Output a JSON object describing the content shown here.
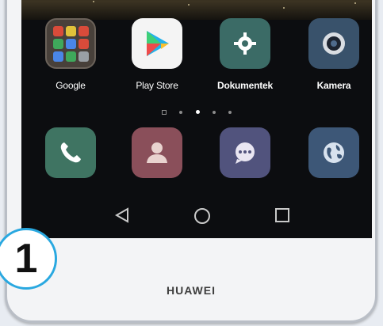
{
  "home": {
    "apps": [
      {
        "label": "Google",
        "icon": "folder-icon"
      },
      {
        "label": "Play Store",
        "icon": "play-store-icon"
      },
      {
        "label": "Dokumentek",
        "icon": "gear-icon"
      },
      {
        "label": "Kamera",
        "icon": "camera-icon"
      }
    ],
    "page_indicator": {
      "pages": 5,
      "active": 2
    }
  },
  "dock": [
    {
      "icon": "phone-icon"
    },
    {
      "icon": "contacts-icon"
    },
    {
      "icon": "messages-icon"
    },
    {
      "icon": "browser-icon"
    }
  ],
  "navbar": [
    {
      "icon": "back-icon"
    },
    {
      "icon": "home-icon"
    },
    {
      "icon": "recents-icon"
    }
  ],
  "device": {
    "brand": "HUAWEI"
  },
  "step": {
    "number": "1"
  },
  "colors": {
    "screen": "#0c0d10",
    "phone_app": "#3f7462",
    "contacts_app": "#8a4f5a",
    "messages_app": "#51537d",
    "browser_app": "#3d5777",
    "settings_app": "#3b6b66",
    "camera_app": "#39526b",
    "badge_border": "#29a8e0"
  }
}
